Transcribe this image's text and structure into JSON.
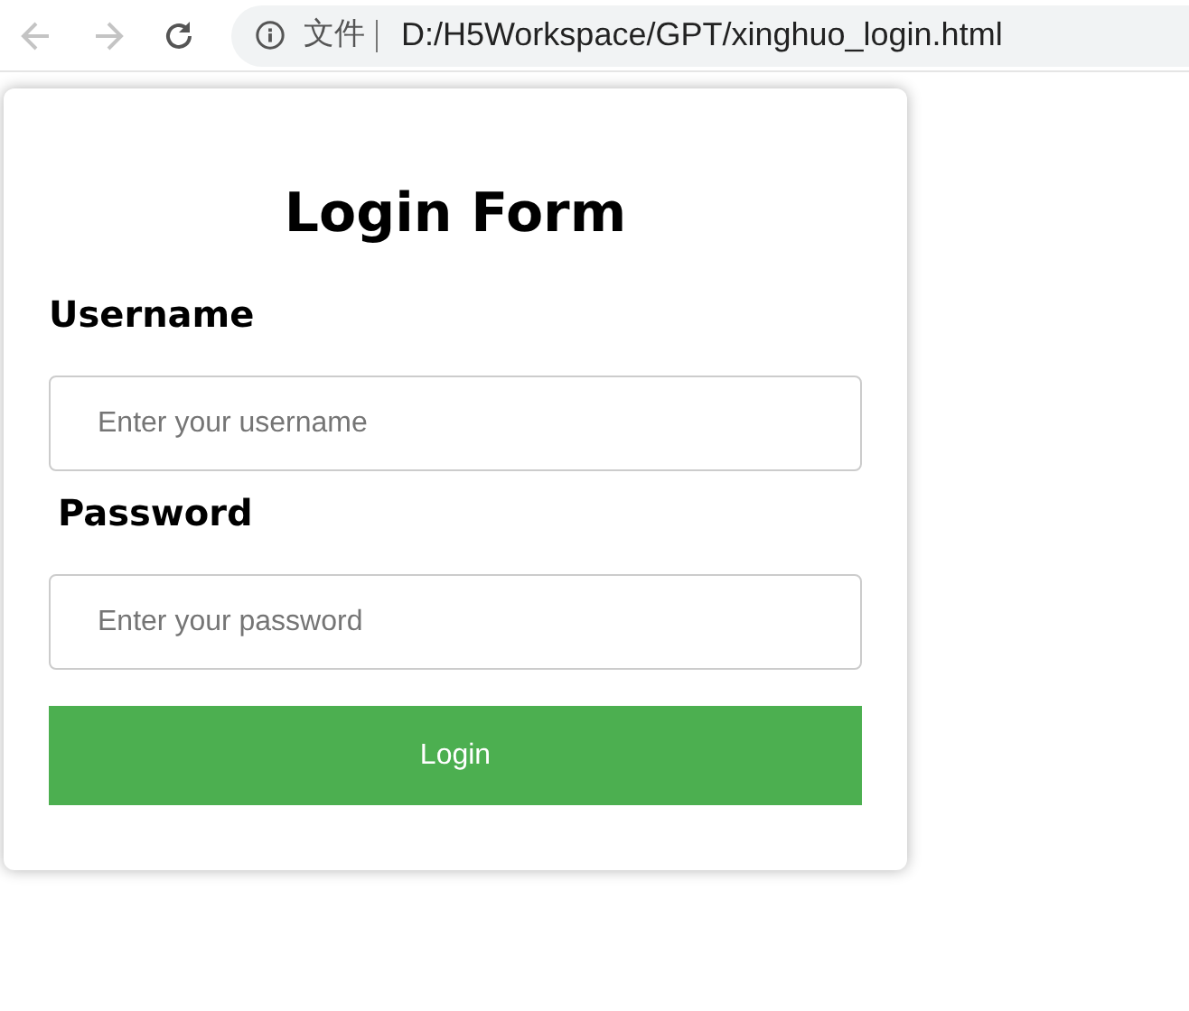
{
  "browser": {
    "security_label": "文件",
    "url": "D:/H5Workspace/GPT/xinghuo_login.html"
  },
  "form": {
    "title": "Login Form",
    "fields": [
      {
        "label": "Username",
        "placeholder": "Enter your username"
      },
      {
        "label": "Password",
        "placeholder": "Enter your password"
      }
    ],
    "button": "Login"
  }
}
